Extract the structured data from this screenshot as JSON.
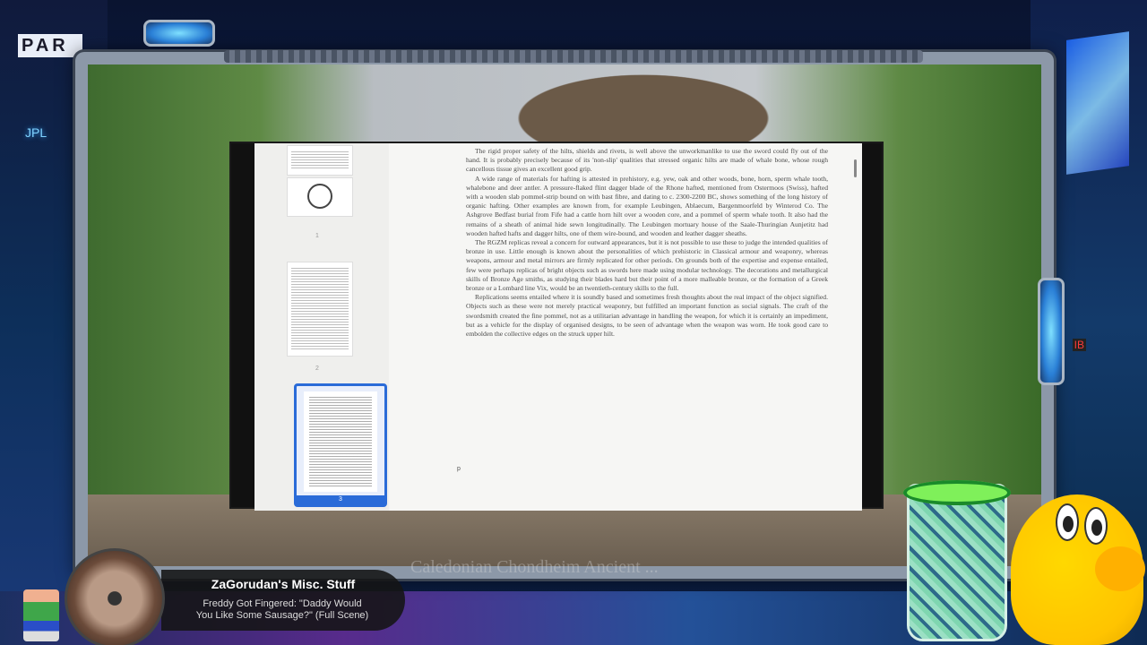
{
  "background": {
    "signs": {
      "par": "PAR",
      "jpl": "JPL",
      "ib": "IB"
    }
  },
  "viewer": {
    "thumbnails": [
      {
        "number": "1"
      },
      {
        "number": "2"
      },
      {
        "number": "3"
      }
    ],
    "page": {
      "paragraphs": [
        "The rigid proper safety of the hilts, shields and rivets, is well above the unworkmanlike to use the sword could fly out of the hand. It is probably precisely because of its 'non-slip' qualities that stressed organic hilts are made of whale bone, whose rough cancellous tissue gives an excellent good grip.",
        "A wide range of materials for hafting is attested in prehistory, e.g. yew, oak and other woods, bone, horn, sperm whale tooth, whalebone and deer antler. A pressure-flaked flint dagger blade of the Rhone hafted, mentioned from Ostermoos (Swiss), hafted with a wooden slab pommel-strip bound on with bast fibre, and dating to c. 2300-2200 BC, shows something of the long history of organic hafting. Other examples are known from, for example Leubingen, Ablaecum, Bargenmoorfeld by Winterod Co. The Ashgrove Bedfast burial from Fife had a cattle horn hilt over a wooden core, and a pommel of sperm whale tooth. It also had the remains of a sheath of animal hide sewn longitudinally. The Leubingen mortuary house of the Saale-Thuringian Aunjetitz had wooden hafted hafts and dagger hilts, one of them wire-bound, and wooden and leather dagger sheaths.",
        "The RGZM replicas reveal a concern for outward appearances, but it is not possible to use these to judge the intended qualities of bronze in use. Little enough is known about the personalities of which prehistoric in Classical armour and weaponry, whereas weapons, armour and metal mirrors are firmly replicated for other periods. On grounds both of the expertise and expense entailed, few were perhaps replicas of bright objects such as swords here made using modular technology. The decorations and metallurgical skills of Bronze Age smiths, as studying their blades hard but their point of a more malleable bronze, or the formation of a Greek bronze or a Lombard line Vix, would be an twentieth-century skills to the full.",
        "Replications seems entailed where it is soundly based and sometimes fresh thoughts about the real impact of the object signified. Objects such as these were not merely practical weaponry, but fulfilled an important function as social signals. The craft of the swordsmith created the fine pommel, not as a utilitarian advantage in handling the weapon, for which it is certainly an impediment, but as a vehicle for the display of organised designs, to be seen of advantage when the weapon was worn. He took good care to embolden the collective edges on the struck upper hilt."
      ],
      "page_mark": "p"
    }
  },
  "ghost_title": "Caledonian Chondheim Ancient ...",
  "now_playing": {
    "channel": "ZaGorudan's Misc. Stuff",
    "title_line1": "Freddy Got Fingered: \"Daddy Would",
    "title_line2": "You Like Some Sausage?\" (Full Scene)"
  }
}
